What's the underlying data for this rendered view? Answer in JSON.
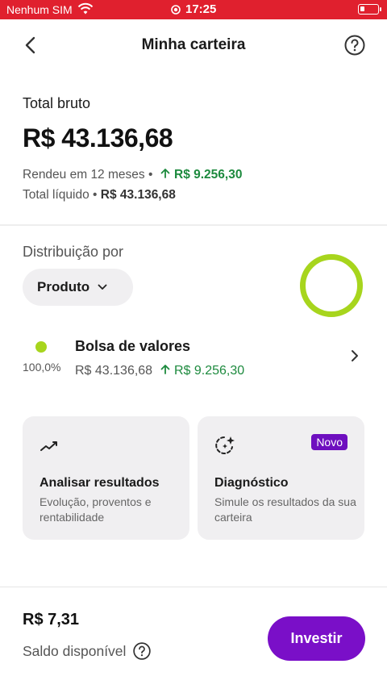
{
  "status_bar": {
    "carrier": "Nenhum SIM",
    "time": "17:25",
    "bar_color": "#e0202e"
  },
  "header": {
    "title": "Minha carteira",
    "back_icon": "chevron-left-icon",
    "help_icon": "help-circle-icon"
  },
  "summary": {
    "label": "Total bruto",
    "value": "R$ 43.136,68",
    "rendeu_label": "Rendeu em 12 meses •",
    "rendeu_value": "R$ 9.256,30",
    "liquido_label": "Total líquido •",
    "liquido_value": "R$ 43.136,68"
  },
  "distribution": {
    "label": "Distribuição por",
    "dropdown_value": "Produto",
    "donut_color": "#a7d51d",
    "items": [
      {
        "color": "#a7d51d",
        "percent": "100,0%",
        "name": "Bolsa de valores",
        "value": "R$ 43.136,68",
        "gain": "R$ 9.256,30"
      }
    ]
  },
  "cards": [
    {
      "title": "Analisar resultados",
      "description": "Evolução, proventos e rentabilidade",
      "icon": "trend-chart-icon"
    },
    {
      "title": "Diagnóstico",
      "description": "Simule os resultados da sua carteira",
      "badge": "Novo",
      "icon": "sparkle-diagnostic-icon"
    }
  ],
  "footer": {
    "balance": "R$ 7,31",
    "balance_label": "Saldo disponível",
    "invest_label": "Investir",
    "accent": "#7a0fc8"
  },
  "colors": {
    "gain": "#1d8a3e",
    "card_bg": "#f0eff1"
  }
}
